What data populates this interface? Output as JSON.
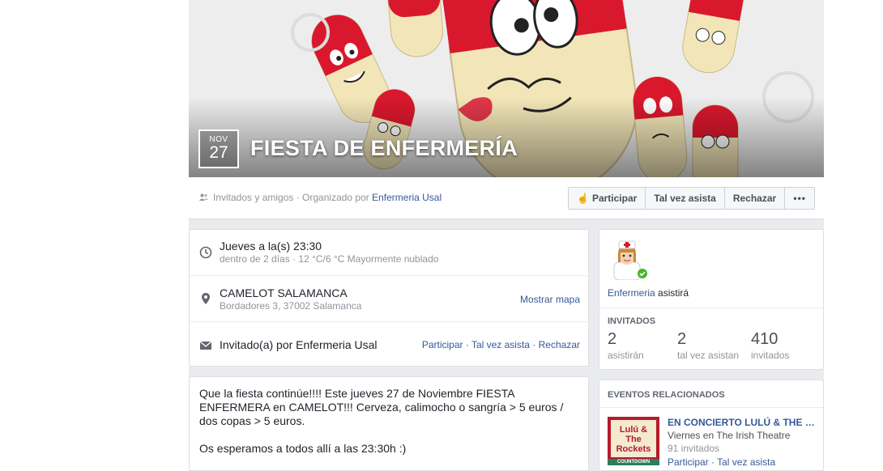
{
  "event": {
    "date_month": "NOV",
    "date_day": "27",
    "title": "FIESTA DE ENFERMERÍA"
  },
  "action_bar": {
    "privacy_text": "Invitados y amigos · Organizado por ",
    "organizer": "Enfermeria Usal",
    "buttons": {
      "participate": "Participar",
      "maybe": "Tal vez asista",
      "decline": "Rechazar",
      "more": "•••"
    }
  },
  "details": {
    "time_main": "Jueves  a la(s) 23:30",
    "time_sub": "dentro de 2 días · 12 °C/6 °C Mayormente nublado",
    "place_main": "CAMELOT SALAMANCA",
    "place_sub": "Bordadores 3, 37002 Salamanca",
    "show_map": "Mostrar mapa",
    "invite_text": "Invitado(a) por Enfermeria Usal",
    "invite_actions": "Participar · Tal vez asista · Rechazar"
  },
  "description": {
    "paragraph1": "Que la fiesta continúe!!!! Este jueves 27 de Noviembre FIESTA ENFERMERA en CAMELOT!!! Cerveza, calimocho o sangría > 5 euros / dos copas > 5 euros.",
    "paragraph2": "Os esperamos a todos allí a las 23:30h :)"
  },
  "attendance": {
    "attendee_name": "Enfermeria",
    "attendee_status": " asistirá",
    "stats_label": "INVITADOS",
    "stats": [
      {
        "num": "2",
        "label": "asistirán"
      },
      {
        "num": "2",
        "label": "tal vez asistan"
      },
      {
        "num": "410",
        "label": "invitados"
      }
    ]
  },
  "related": {
    "heading": "EVENTOS RELACIONADOS",
    "title": "EN CONCIERTO LULÚ & THE ROCKETS",
    "venue": "Viernes en The Irish Theatre",
    "invited": "91 invitados",
    "actions": "Participar · Tal vez asista",
    "thumb_text": "Lulú & The Rockets",
    "thumb_banner": "COUNTDOWN"
  },
  "icon_names": [
    "friends-icon",
    "thumbs-up-icon",
    "clock-icon",
    "map-pin-icon",
    "envelope-icon",
    "check-badge-icon"
  ],
  "colors": {
    "link": "#365899",
    "pill_red": "#d9182d",
    "pill_cream": "#f2e6b8",
    "background": "#e9ebee"
  }
}
